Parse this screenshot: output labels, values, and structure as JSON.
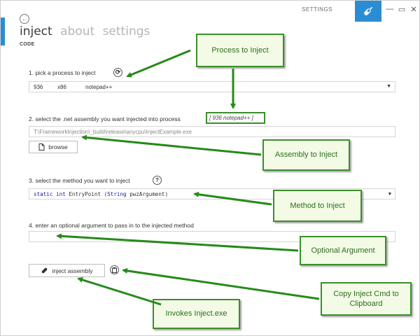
{
  "window": {
    "title": "SETTINGS"
  },
  "titlebar": {
    "minimize": "—",
    "maximize": "▭",
    "close": "✕"
  },
  "nav": {
    "items": [
      {
        "label": "inject",
        "active": true
      },
      {
        "label": "about",
        "active": false
      },
      {
        "label": "settings",
        "active": false
      }
    ],
    "sub": "CODE"
  },
  "step1": {
    "label": "1.  pick a process to inject",
    "process": {
      "pid": "936",
      "arch": "x86",
      "name": "notepad++"
    }
  },
  "step2": {
    "label": "2.  select the .net assembly you want injected into process",
    "process_tag": "[ 936 notepad++ ]",
    "path": "T:\\FrameworkInjection\\_build\\release\\anycpu\\InjectExample.exe",
    "browse": "browse"
  },
  "step3": {
    "label": "3.  select the method you want to inject",
    "help": "?",
    "method": {
      "kw1": "static",
      "kw2": "int",
      "name": "EntryPoint (",
      "type": "String",
      "arg": "pwzArgument)"
    }
  },
  "step4": {
    "label": "4.  enter an optional argument to pass in to the injected method",
    "value": ""
  },
  "inject_button": "inject assembly",
  "callouts": {
    "process": "Process to Inject",
    "assembly": "Assembly to Inject",
    "method": "Method to Inject",
    "argument": "Optional Argument",
    "copy": "Copy Inject Cmd to Clipboard",
    "invokes": "Invokes Inject.exe"
  },
  "colors": {
    "accent": "#2a8dd4",
    "callout_border": "#3a8f2a",
    "callout_bg": "#f3fbe6",
    "callout_text": "#2c6e1e"
  }
}
